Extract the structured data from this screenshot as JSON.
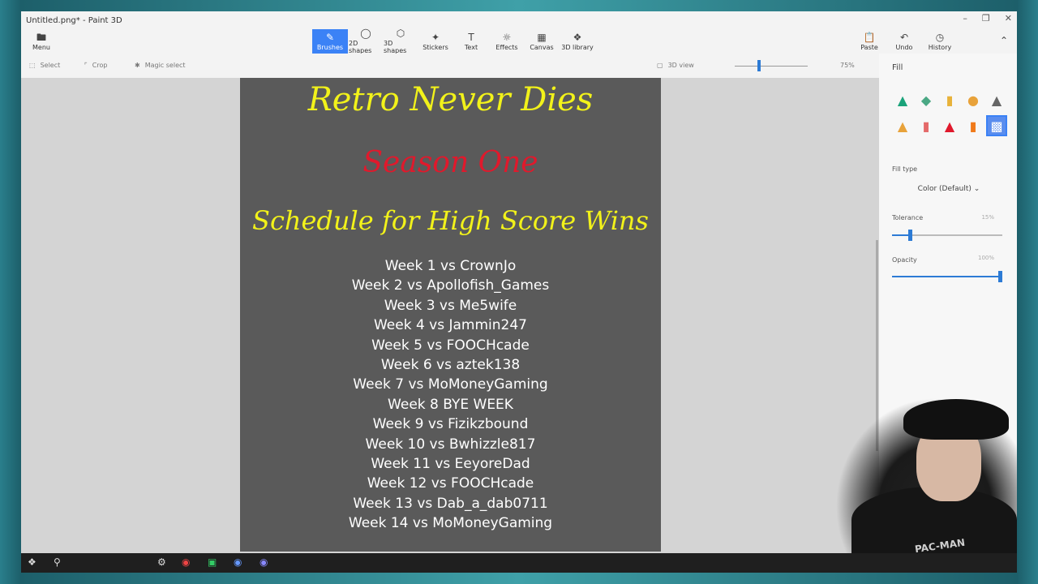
{
  "window": {
    "title": "Untitled.png* - Paint 3D"
  },
  "ribbon": {
    "menu": "Menu",
    "tools": [
      "Brushes",
      "2D shapes",
      "3D shapes",
      "Stickers",
      "Text",
      "Effects",
      "Canvas",
      "3D library"
    ],
    "paste": "Paste",
    "undo": "Undo",
    "history": "History"
  },
  "subbar": {
    "select": "Select",
    "crop": "Crop",
    "magic_select": "Magic select",
    "view_3d": "3D view",
    "zoom": "75%"
  },
  "canvas": {
    "title": "Retro Never Dies",
    "season": "Season One",
    "subtitle": "Schedule for High Score Wins",
    "schedule": [
      "Week 1 vs CrownJo",
      "Week 2 vs Apollofish_Games",
      "Week 3 vs Me5wife",
      "Week 4 vs Jammin247",
      "Week 5 vs FOOCHcade",
      "Week 6 vs aztek138",
      "Week 7 vs MoMoneyGaming",
      "Week 8  BYE WEEK",
      "Week 9 vs Fizikzbound",
      "Week 10 vs Bwhizzle817",
      "Week 11 vs EeyoreDad",
      "Week 12 vs FOOCHcade",
      "Week 13 vs Dab_a_dab0711",
      "Week 14 vs MoMoneyGaming"
    ]
  },
  "panel": {
    "header": "Fill",
    "fill_type_label": "Fill type",
    "fill_type_value": "Color (Default)",
    "tolerance_label": "Tolerance",
    "tolerance_value": "15%",
    "tolerance_fraction": 0.15,
    "opacity_label": "Opacity",
    "opacity_value": "100%",
    "opacity_fraction": 1.0
  },
  "webcam": {
    "shirt_text": "PAC-MAN"
  },
  "colors": {
    "accent": "#3b82f6",
    "title_yellow": "#f2f21a",
    "season_red": "#e0192c",
    "canvas_bg": "#5a5a5a"
  },
  "icons": [
    "folder-icon",
    "brush-icon",
    "shape-2d-icon",
    "shape-3d-icon",
    "sticker-icon",
    "text-icon",
    "effects-icon",
    "canvas-icon",
    "library-icon",
    "paste-icon",
    "undo-icon",
    "history-icon"
  ]
}
